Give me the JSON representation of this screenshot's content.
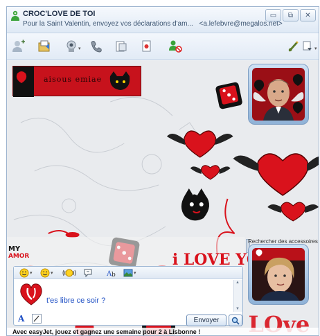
{
  "window": {
    "title": "CROC'LOVE DE TOI",
    "subtitle": "Pour la Saint Valentin, envoyez vos déclarations d'am...",
    "email": "<a.lefebvre@megalos.net>",
    "controls": {
      "minimize": "▭",
      "maximize": "⧉",
      "close": "✕"
    }
  },
  "toolbar": {
    "icons": [
      "invite-contact-icon",
      "send-files-icon",
      "webcam-icon",
      "call-icon",
      "activities-icon",
      "games-icon",
      "block-icon",
      "theme-brush-icon",
      "menu-icon"
    ]
  },
  "scene": {
    "banner_text": "aisous emiae",
    "love_text": "i LOVE YOU",
    "love_text_2": "LOve",
    "accessories_caption": "Rechercher des accessoires"
  },
  "compose": {
    "typed_text": "t'es libre ce soir ?",
    "font_label": "A",
    "send_label": "Envoyer",
    "icons": [
      "emoticon-icon",
      "wink-icon",
      "nudge-icon",
      "voice-clip-icon",
      "text-format-icon",
      "background-icon"
    ]
  },
  "ad": {
    "text": "Avec easyJet, jouez et gagnez une semaine pour 2 à Lisbonne !"
  },
  "colors": {
    "accent": "#c7121c",
    "window_border": "#9db4cf",
    "link_blue": "#1e4fc4"
  }
}
